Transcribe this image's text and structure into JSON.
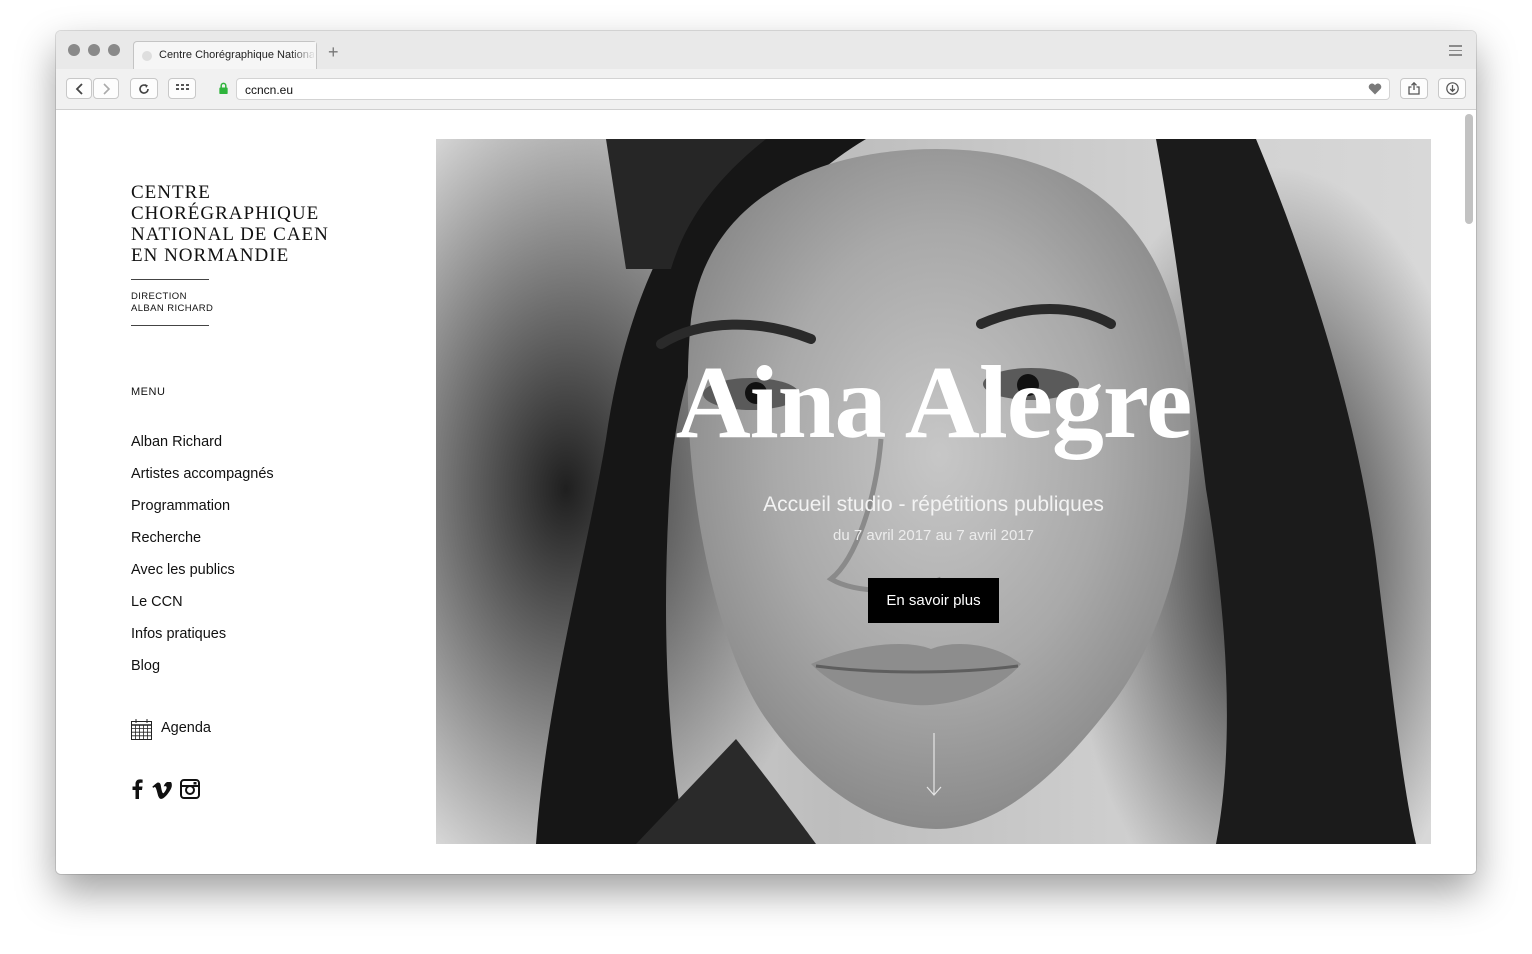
{
  "browser": {
    "tab_title": "Centre Chorégraphique National de Caen",
    "url": "ccncn.eu"
  },
  "site": {
    "logo_lines": [
      "CENTRE",
      "CHORÉGRAPHIQUE",
      "NATIONAL DE CAEN",
      "EN NORMANDIE"
    ],
    "direction_lines": [
      "DIRECTION",
      "ALBAN RICHARD"
    ],
    "menu_heading": "MENU",
    "menu_items": [
      "Alban Richard",
      "Artistes accompagnés",
      "Programmation",
      "Recherche",
      "Avec les publics",
      "Le CCN",
      "Infos pratiques",
      "Blog"
    ],
    "agenda_label": "Agenda",
    "social_icons": [
      "facebook-icon",
      "vimeo-icon",
      "instagram-icon"
    ]
  },
  "hero": {
    "title": "Aina Alegre",
    "subtitle": "Accueil studio - répétitions publiques",
    "date": "du 7 avril 2017 au 7 avril 2017",
    "cta_label": "En savoir plus"
  },
  "colors": {
    "cta_background": "#000000",
    "secure_lock": "#2fb43c",
    "text": "#111111"
  }
}
